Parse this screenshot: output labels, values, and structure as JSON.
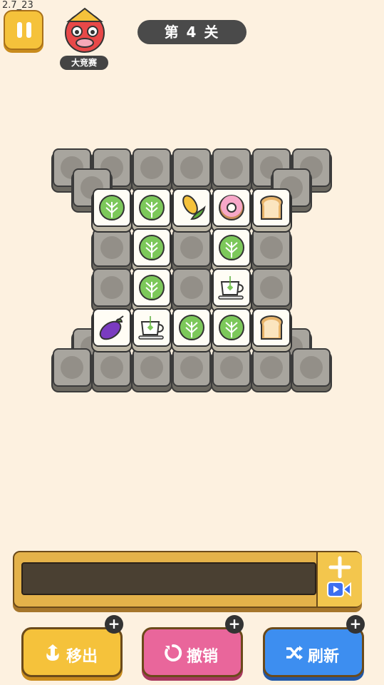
{
  "status": {
    "version": "2.7_23"
  },
  "header": {
    "contest_label": "大竞赛",
    "level_label": "第 4 关"
  },
  "board": {
    "top_row": [
      "lettuce",
      "lettuce",
      "corn",
      "donut",
      "bread"
    ],
    "mid_row1": [
      "lettuce",
      "lettuce"
    ],
    "mid_row2": [
      "lettuce",
      "teacup"
    ],
    "bottom_row": [
      "eggplant",
      "teacup",
      "lettuce",
      "lettuce",
      "bread"
    ]
  },
  "actions": {
    "move_out": "移出",
    "undo": "撤销",
    "shuffle": "刷新",
    "badge": "+"
  },
  "colors": {
    "background": "#fdf1e0",
    "yellow": "#f5c23b",
    "pink": "#e9669b",
    "blue": "#3d8ef0"
  }
}
